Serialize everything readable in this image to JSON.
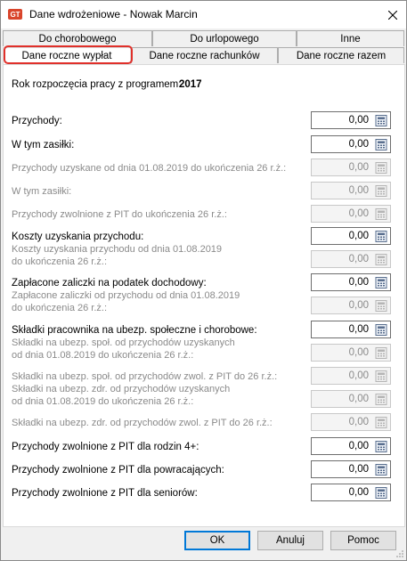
{
  "window": {
    "title": "Dane wdrożeniowe - Nowak Marcin"
  },
  "tabs": {
    "row1": [
      "Do chorobowego",
      "Do urlopowego",
      "Inne"
    ],
    "row2": [
      "Dane roczne wypłat",
      "Dane roczne rachunków",
      "Dane roczne razem"
    ],
    "active": "Dane roczne wypłat"
  },
  "start_year": {
    "label": "Rok rozpoczęcia pracy z programem:",
    "value": "2017"
  },
  "fields": [
    {
      "label": "Przychody:",
      "value": "0,00",
      "enabled": true
    },
    {
      "label": "W tym zasiłki:",
      "value": "0,00",
      "enabled": true
    },
    {
      "label": "Przychody uzyskane od dnia 01.08.2019 do ukończenia 26 r.ż.:",
      "value": "0,00",
      "enabled": false
    },
    {
      "label": "W tym zasiłki:",
      "value": "0,00",
      "enabled": false
    },
    {
      "label": "Przychody zwolnione z PIT do ukończenia 26 r.ż.:",
      "value": "0,00",
      "enabled": false
    },
    {
      "label": "Koszty uzyskania przychodu:",
      "value": "0,00",
      "enabled": true
    },
    {
      "label": "Koszty uzyskania przychodu od dnia 01.08.2019\ndo ukończenia 26 r.ż.:",
      "value": "0,00",
      "enabled": false
    },
    {
      "label": "Zapłacone zaliczki na podatek dochodowy:",
      "value": "0,00",
      "enabled": true
    },
    {
      "label": "Zapłacone zaliczki od przychodu od dnia 01.08.2019\ndo ukończenia 26 r.ż.:",
      "value": "0,00",
      "enabled": false
    },
    {
      "label": "Składki pracownika na ubezp. społeczne i chorobowe:",
      "value": "0,00",
      "enabled": true
    },
    {
      "label": "Składki na ubezp. społ. od przychodów uzyskanych\nod dnia 01.08.2019 do ukończenia 26 r.ż.:",
      "value": "0,00",
      "enabled": false
    },
    {
      "label": "Składki na ubezp. społ. od przychodów zwol. z PIT do 26 r.ż.:",
      "value": "0,00",
      "enabled": false
    },
    {
      "label": "Składki na ubezp. zdr. od przychodów uzyskanych\nod dnia 01.08.2019 do ukończenia 26 r.ż.:",
      "value": "0,00",
      "enabled": false
    },
    {
      "label": "Składki na ubezp. zdr. od przychodów zwol. z PIT do 26 r.ż.:",
      "value": "0,00",
      "enabled": false
    },
    {
      "label": "Przychody zwolnione z PIT dla rodzin 4+:",
      "value": "0,00",
      "enabled": true
    },
    {
      "label": "Przychody zwolnione z PIT dla powracających:",
      "value": "0,00",
      "enabled": true
    },
    {
      "label": "Przychody zwolnione z PIT dla seniorów:",
      "value": "0,00",
      "enabled": true
    }
  ],
  "buttons": {
    "ok": "OK",
    "cancel": "Anuluj",
    "help": "Pomoc"
  }
}
